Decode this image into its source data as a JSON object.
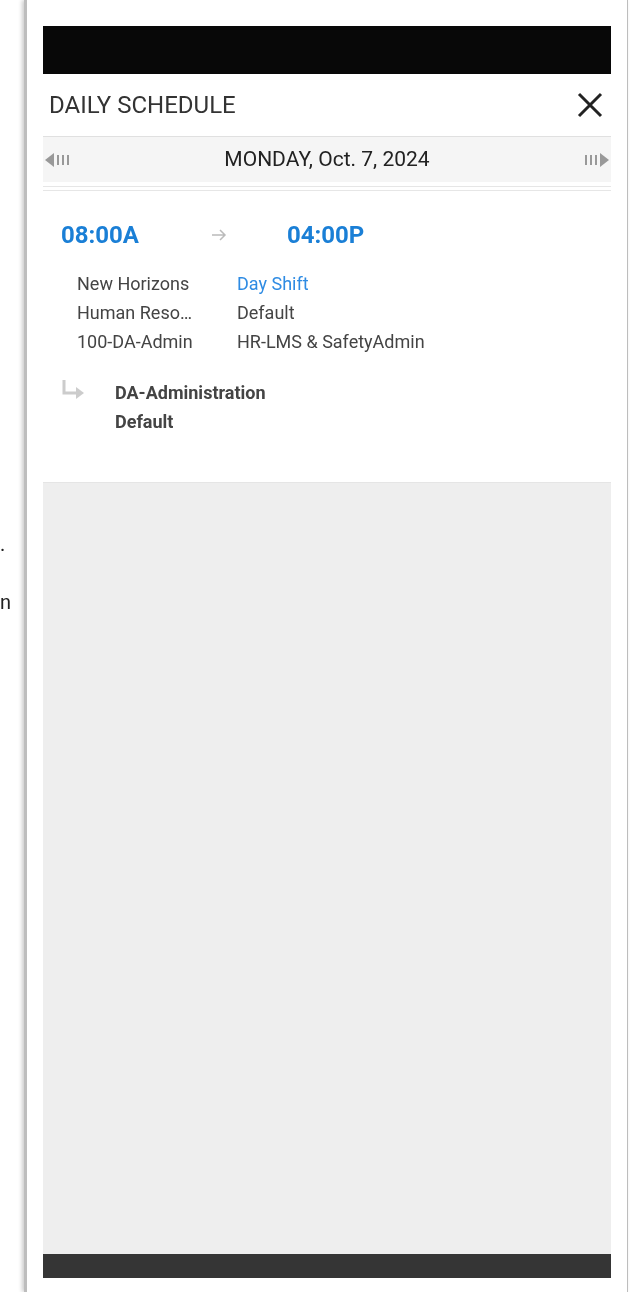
{
  "edge_text": [
    ".",
    "n"
  ],
  "header": {
    "title": "DAILY SCHEDULE"
  },
  "date_bar": {
    "date": "MONDAY, Oct. 7, 2024"
  },
  "shift": {
    "start": "08:00A",
    "end": "04:00P",
    "details": [
      {
        "left": "New Horizons",
        "right": "Day Shift",
        "kind": "link"
      },
      {
        "left": "Human Reso…",
        "right": "Default",
        "kind": "plain"
      },
      {
        "left": "100-DA-Admin",
        "right": "HR-LMS & SafetyAdmin",
        "kind": "plain"
      }
    ],
    "transfer": [
      "DA-Administration",
      "Default"
    ]
  }
}
